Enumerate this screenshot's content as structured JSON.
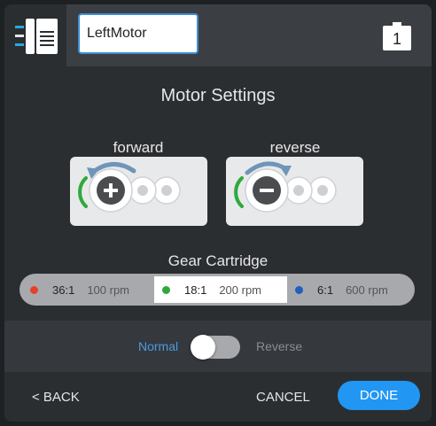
{
  "header": {
    "device_icon": "motor-device-icon",
    "motor_name_value": "LeftMotor",
    "port_number": "1",
    "port_icon": "port-icon"
  },
  "settings": {
    "title": "Motor Settings",
    "directions": [
      {
        "label": "forward",
        "icon": "plus-gear-icon"
      },
      {
        "label": "reverse",
        "icon": "minus-gear-icon"
      }
    ]
  },
  "gear_cartridge": {
    "title": "Gear Cartridge",
    "options": [
      {
        "ratio": "36:1",
        "rpm": "100 rpm",
        "color": "#e8402c",
        "selected": false
      },
      {
        "ratio": "18:1",
        "rpm": "200 rpm",
        "color": "#2eaa3c",
        "selected": true
      },
      {
        "ratio": "6:1",
        "rpm": "600 rpm",
        "color": "#1f5fbf",
        "selected": false
      }
    ]
  },
  "direction_toggle": {
    "normal_label": "Normal",
    "reverse_label": "Reverse",
    "state": "Normal"
  },
  "footer": {
    "back_label": "< BACK",
    "cancel_label": "CANCEL",
    "done_label": "DONE"
  },
  "colors": {
    "accent": "#2196f3",
    "highlight_text": "#4a9be4",
    "rotation_arrow_forward": "#2eaa3c",
    "rotation_arrow_reverse": "#6f95b8"
  }
}
